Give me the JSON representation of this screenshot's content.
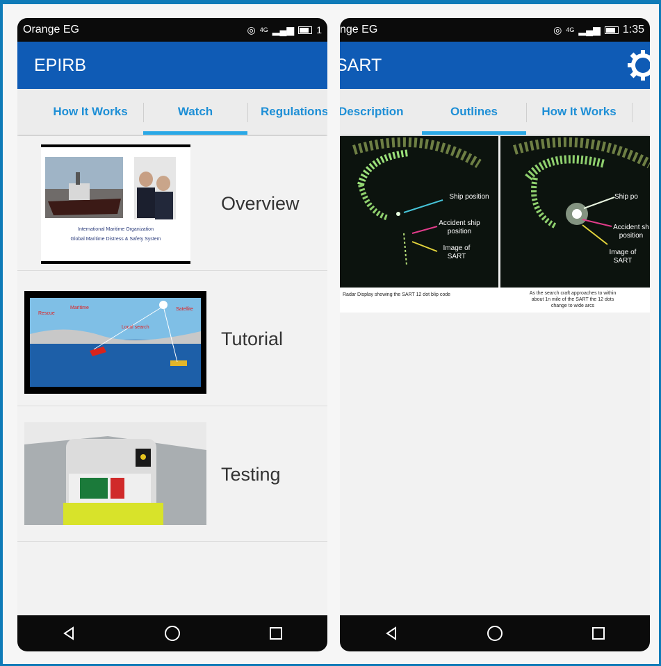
{
  "left_screen": {
    "status": {
      "carrier": "Orange EG",
      "net": "4G",
      "time": "1"
    },
    "title": "EPIRB",
    "tabs": [
      "How It Works",
      "Watch",
      "Regulations"
    ],
    "active_tab": "Watch",
    "items": [
      {
        "label": "Overview",
        "thumb_caption1": "International Maritime Organization",
        "thumb_caption2": "Global Maritime Distress & Safety System"
      },
      {
        "label": "Tutorial"
      },
      {
        "label": "Testing"
      }
    ]
  },
  "right_screen": {
    "status": {
      "carrier": "nge EG",
      "net": "4G",
      "time": "1:35"
    },
    "title": "SART",
    "tabs": [
      "Description",
      "Outlines",
      "How It Works"
    ],
    "active_tab": "Outlines",
    "figure": {
      "left_labels": [
        "Ship position",
        "Accident ship position",
        "Image of SART"
      ],
      "right_labels": [
        "Ship po",
        "Accident sh position",
        "Image of SART"
      ],
      "caption_left": "Radar Display showing the SART 12 dot blip code",
      "caption_right": "As the search craft approaches to within about 1n mile of the SART the 12 dots change to wide arcs"
    }
  },
  "nav_icons": [
    "back-icon",
    "home-icon",
    "recents-icon"
  ],
  "colors": {
    "appbar": "#0f5bb5",
    "tab_text": "#1e8fd6",
    "indicator": "#2aa8e6",
    "border": "#0f7bb8"
  }
}
